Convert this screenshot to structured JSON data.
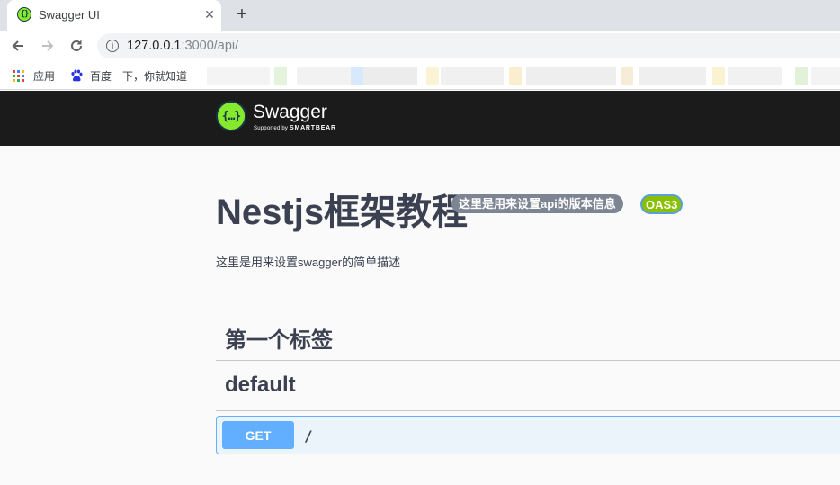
{
  "browser": {
    "tab_title": "Swagger UI",
    "tab_close": "✕",
    "new_tab": "+",
    "url_host": "127.0.0.1",
    "url_rest": ":3000/api/",
    "bookmarks": [
      {
        "label": "应用",
        "icon": "apps-grid-icon"
      },
      {
        "label": "百度一下，你就知道",
        "icon": "baidu-paw-icon"
      }
    ]
  },
  "swagger": {
    "logo_icon": "{…}",
    "logo_word": "Swagger",
    "logo_tag_prefix": "Supported by ",
    "logo_tag_brand": "SMARTBEAR",
    "title": "Nestjs框架教程",
    "version_badge": "这里是用来设置api的版本信息",
    "oas_badge": "OAS3",
    "description": "这里是用来设置swagger的简单描述",
    "tags": [
      {
        "name": "第一个标签"
      },
      {
        "name": "default"
      }
    ],
    "operation": {
      "method": "GET",
      "path": "/"
    }
  },
  "colors": {
    "get_method": "#61affe",
    "oas_badge": "#89bf04",
    "topbar": "#1b1b1b",
    "swagger_green": "#85ea2d"
  }
}
